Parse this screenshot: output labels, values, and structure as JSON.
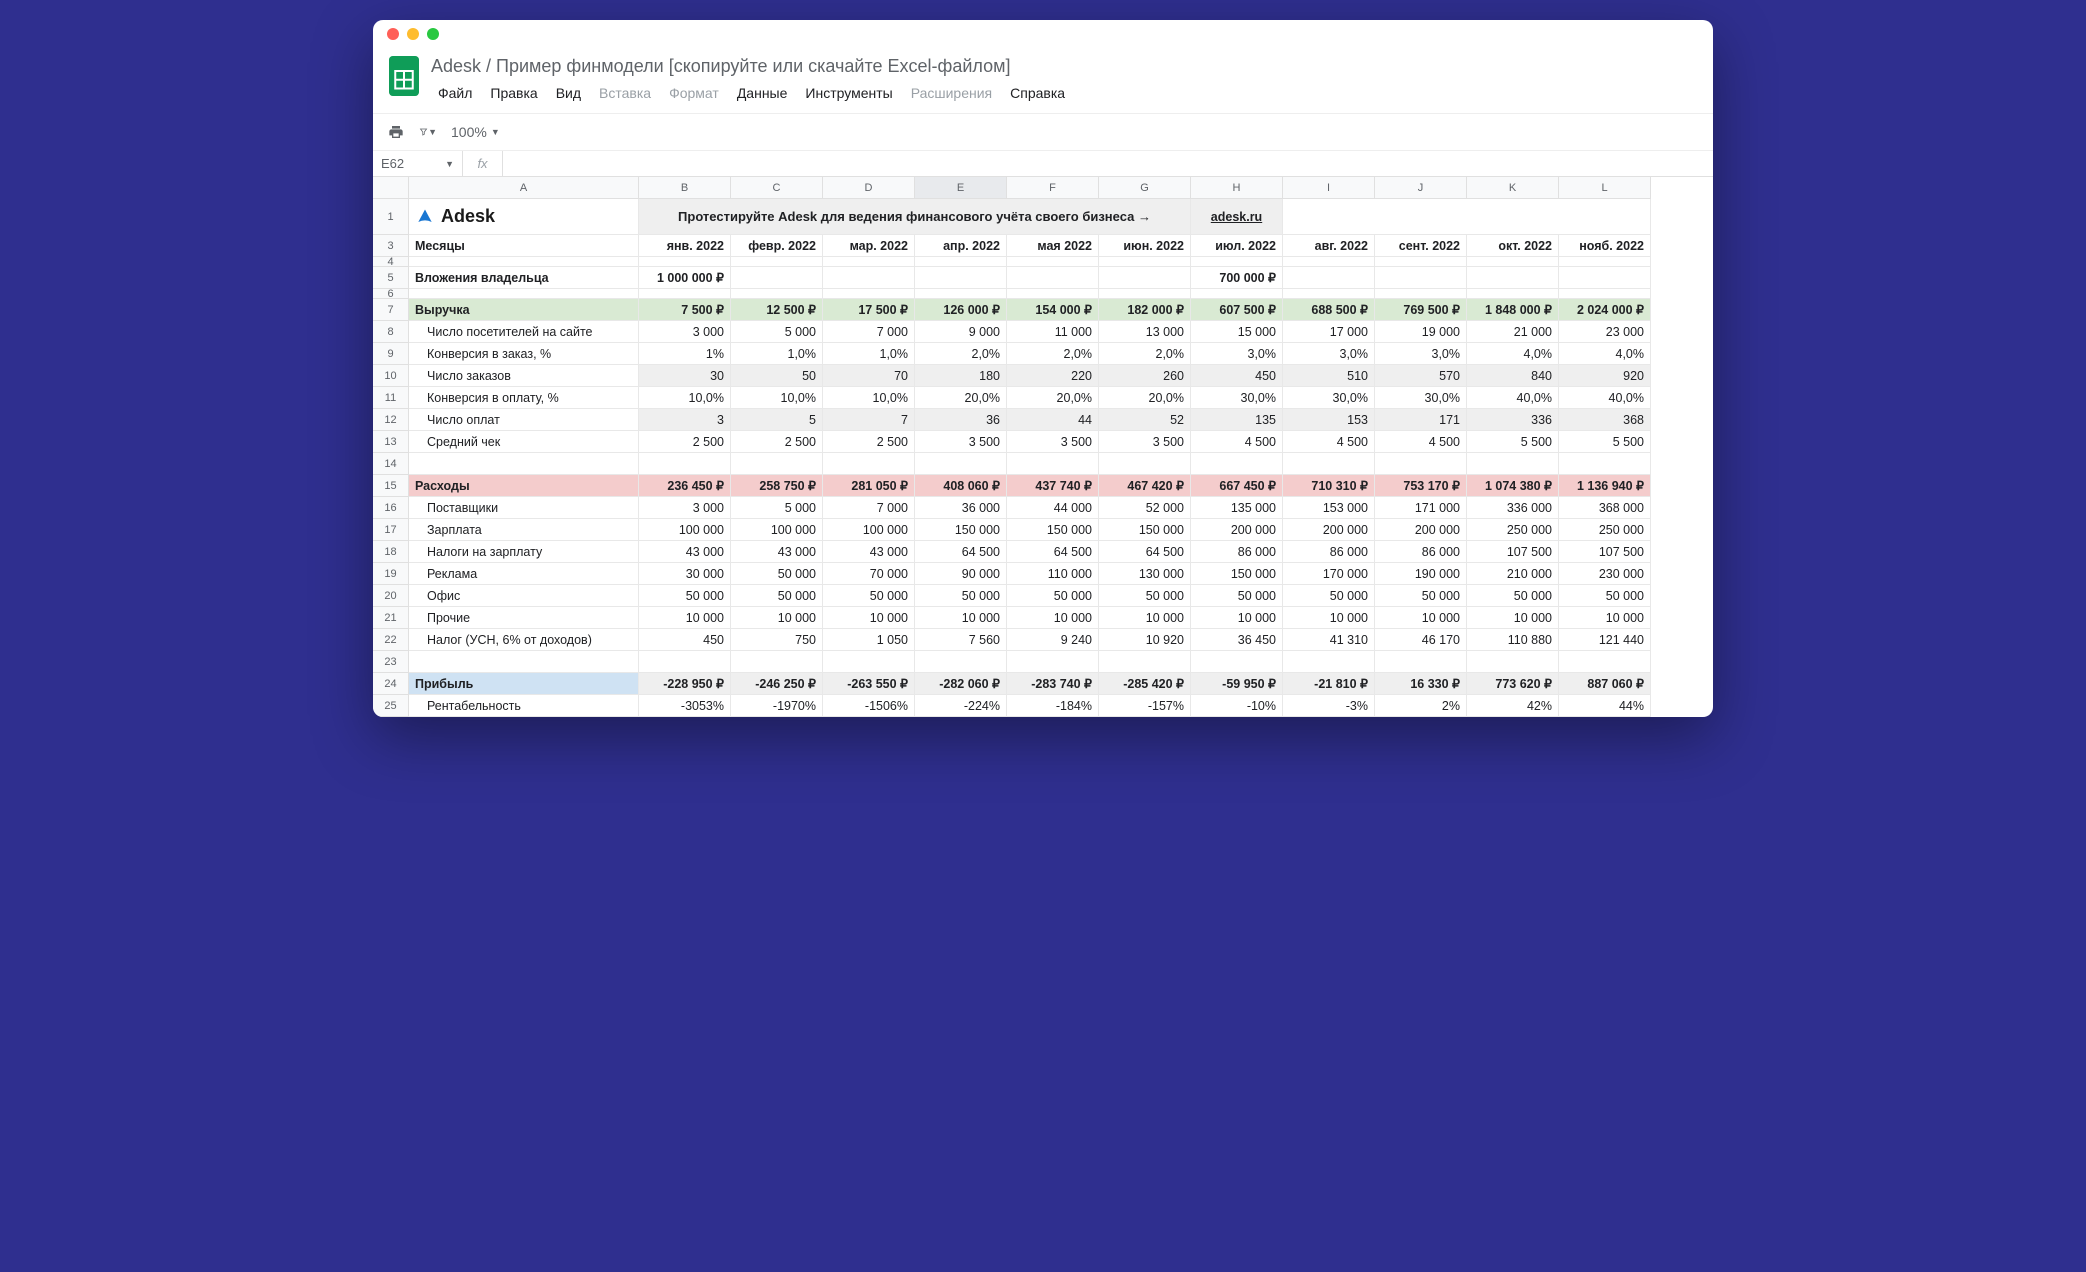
{
  "doc_title": "Adesk /  Пример финмодели [скопируйте или скачайте Excel-файлом]",
  "menubar": [
    "Файл",
    "Правка",
    "Вид",
    "Вставка",
    "Формат",
    "Данные",
    "Инструменты",
    "Расширения",
    "Справка"
  ],
  "menubar_dim": [
    false,
    false,
    false,
    true,
    true,
    false,
    false,
    true,
    false
  ],
  "zoom": "100%",
  "namebox": "E62",
  "col_headers": [
    "A",
    "B",
    "C",
    "D",
    "E",
    "F",
    "G",
    "H",
    "I",
    "J",
    "K",
    "L"
  ],
  "selected_col": "E",
  "row_numbers": [
    "1",
    "3",
    "4",
    "5",
    "6",
    "7",
    "8",
    "9",
    "10",
    "11",
    "12",
    "13",
    "14",
    "15",
    "16",
    "17",
    "18",
    "19",
    "20",
    "21",
    "22",
    "23",
    "24",
    "25"
  ],
  "logo_text": "Adesk",
  "banner_text": "Протестируйте Adesk для ведения финансового учёта своего бизнеса  →",
  "banner_link": "adesk.ru",
  "months_label": "Месяцы",
  "months": [
    "янв. 2022",
    "февр. 2022",
    "мар. 2022",
    "апр. 2022",
    "мая 2022",
    "июн. 2022",
    "июл. 2022",
    "авг. 2022",
    "сент. 2022",
    "окт. 2022",
    "нояб. 2022"
  ],
  "rows": {
    "owner_invest": {
      "label": "Вложения владельца",
      "values": [
        "1 000 000 ₽",
        "",
        "",
        "",
        "",
        "",
        "700 000 ₽",
        "",
        "",
        "",
        ""
      ]
    },
    "revenue": {
      "label": "Выручка",
      "values": [
        "7 500 ₽",
        "12 500 ₽",
        "17 500 ₽",
        "126 000 ₽",
        "154 000 ₽",
        "182 000 ₽",
        "607 500 ₽",
        "688 500 ₽",
        "769 500 ₽",
        "1 848 000 ₽",
        "2 024 000 ₽"
      ]
    },
    "visitors": {
      "label": "Число посетителей на сайте",
      "values": [
        "3 000",
        "5 000",
        "7 000",
        "9 000",
        "11 000",
        "13 000",
        "15 000",
        "17 000",
        "19 000",
        "21 000",
        "23 000"
      ]
    },
    "conv_order": {
      "label": "Конверсия в заказ, %",
      "values": [
        "1%",
        "1,0%",
        "1,0%",
        "2,0%",
        "2,0%",
        "2,0%",
        "3,0%",
        "3,0%",
        "3,0%",
        "4,0%",
        "4,0%"
      ]
    },
    "orders": {
      "label": "Число заказов",
      "values": [
        "30",
        "50",
        "70",
        "180",
        "220",
        "260",
        "450",
        "510",
        "570",
        "840",
        "920"
      ]
    },
    "conv_pay": {
      "label": "Конверсия в оплату, %",
      "values": [
        "10,0%",
        "10,0%",
        "10,0%",
        "20,0%",
        "20,0%",
        "20,0%",
        "30,0%",
        "30,0%",
        "30,0%",
        "40,0%",
        "40,0%"
      ]
    },
    "payments": {
      "label": "Число оплат",
      "values": [
        "3",
        "5",
        "7",
        "36",
        "44",
        "52",
        "135",
        "153",
        "171",
        "336",
        "368"
      ]
    },
    "avg_check": {
      "label": "Средний чек",
      "values": [
        "2 500",
        "2 500",
        "2 500",
        "3 500",
        "3 500",
        "3 500",
        "4 500",
        "4 500",
        "4 500",
        "5 500",
        "5 500"
      ]
    },
    "expenses": {
      "label": "Расходы",
      "values": [
        "236 450 ₽",
        "258 750 ₽",
        "281 050 ₽",
        "408 060 ₽",
        "437 740 ₽",
        "467 420 ₽",
        "667 450 ₽",
        "710 310 ₽",
        "753 170 ₽",
        "1 074 380 ₽",
        "1 136 940 ₽"
      ]
    },
    "suppliers": {
      "label": "Поставщики",
      "values": [
        "3 000",
        "5 000",
        "7 000",
        "36 000",
        "44 000",
        "52 000",
        "135 000",
        "153 000",
        "171 000",
        "336 000",
        "368 000"
      ]
    },
    "salary": {
      "label": "Зарплата",
      "values": [
        "100 000",
        "100 000",
        "100 000",
        "150 000",
        "150 000",
        "150 000",
        "200 000",
        "200 000",
        "200 000",
        "250 000",
        "250 000"
      ]
    },
    "salary_tax": {
      "label": "Налоги на зарплату",
      "values": [
        "43 000",
        "43 000",
        "43 000",
        "64 500",
        "64 500",
        "64 500",
        "86 000",
        "86 000",
        "86 000",
        "107 500",
        "107 500"
      ]
    },
    "ads": {
      "label": "Реклама",
      "values": [
        "30 000",
        "50 000",
        "70 000",
        "90 000",
        "110 000",
        "130 000",
        "150 000",
        "170 000",
        "190 000",
        "210 000",
        "230 000"
      ]
    },
    "office": {
      "label": "Офис",
      "values": [
        "50 000",
        "50 000",
        "50 000",
        "50 000",
        "50 000",
        "50 000",
        "50 000",
        "50 000",
        "50 000",
        "50 000",
        "50 000"
      ]
    },
    "other": {
      "label": "Прочие",
      "values": [
        "10 000",
        "10 000",
        "10 000",
        "10 000",
        "10 000",
        "10 000",
        "10 000",
        "10 000",
        "10 000",
        "10 000",
        "10 000"
      ]
    },
    "usn_tax": {
      "label": "Налог (УСН, 6% от доходов)",
      "values": [
        "450",
        "750",
        "1 050",
        "7 560",
        "9 240",
        "10 920",
        "36 450",
        "41 310",
        "46 170",
        "110 880",
        "121 440"
      ]
    },
    "profit": {
      "label": "Прибыль",
      "values": [
        "-228 950 ₽",
        "-246 250 ₽",
        "-263 550 ₽",
        "-282 060 ₽",
        "-283 740 ₽",
        "-285 420 ₽",
        "-59 950 ₽",
        "-21 810 ₽",
        "16 330 ₽",
        "773 620 ₽",
        "887 060 ₽"
      ]
    },
    "margin": {
      "label": "Рентабельность",
      "values": [
        "-3053%",
        "-1970%",
        "-1506%",
        "-224%",
        "-184%",
        "-157%",
        "-10%",
        "-3%",
        "2%",
        "42%",
        "44%"
      ]
    }
  }
}
